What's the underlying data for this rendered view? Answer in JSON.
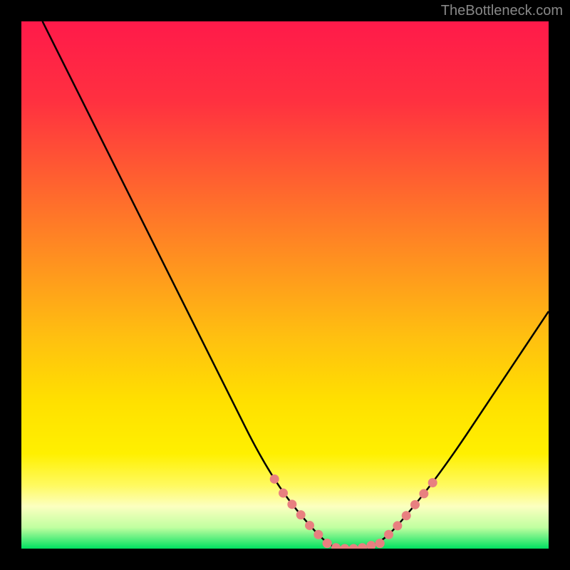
{
  "watermark": "TheBottleneck.com",
  "chart_data": {
    "type": "line",
    "title": "",
    "xlabel": "",
    "ylabel": "",
    "xlim": [
      0,
      100
    ],
    "ylim": [
      0,
      100
    ],
    "series": [
      {
        "name": "bottleneck-curve",
        "x": [
          4,
          10,
          20,
          30,
          40,
          45,
          50,
          55,
          58,
          60,
          64,
          68,
          72,
          80,
          90,
          100
        ],
        "y": [
          100,
          88,
          68,
          48,
          28,
          18,
          10,
          4,
          1,
          0,
          0,
          1,
          5,
          15,
          30,
          45
        ]
      }
    ],
    "highlight_regions": [
      {
        "name": "left-descent-dots",
        "x_range": [
          48,
          58
        ],
        "style": "salmon-dots"
      },
      {
        "name": "trough-dots",
        "x_range": [
          58,
          68
        ],
        "style": "salmon-dots"
      },
      {
        "name": "right-ascent-dots",
        "x_range": [
          68,
          78
        ],
        "style": "salmon-dots"
      }
    ],
    "gradient_stops": [
      {
        "offset": 0.0,
        "color": "#ff1a4a"
      },
      {
        "offset": 0.15,
        "color": "#ff3040"
      },
      {
        "offset": 0.3,
        "color": "#ff6030"
      },
      {
        "offset": 0.45,
        "color": "#ff9020"
      },
      {
        "offset": 0.6,
        "color": "#ffc010"
      },
      {
        "offset": 0.72,
        "color": "#ffe000"
      },
      {
        "offset": 0.82,
        "color": "#fff000"
      },
      {
        "offset": 0.88,
        "color": "#fffa60"
      },
      {
        "offset": 0.92,
        "color": "#fcffc0"
      },
      {
        "offset": 0.96,
        "color": "#c0ffa0"
      },
      {
        "offset": 1.0,
        "color": "#00e060"
      }
    ]
  }
}
